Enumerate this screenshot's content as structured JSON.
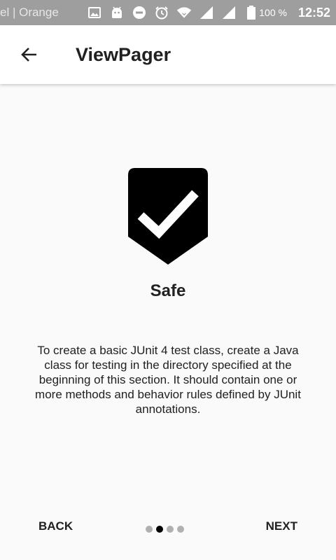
{
  "status_bar": {
    "carrier": "el | Orange",
    "battery": "100 %",
    "time": "12:52",
    "icons_left": [
      "image-icon",
      "android-icon",
      "do-not-disturb-icon",
      "alarm-icon",
      "wifi-icon",
      "signal-icon",
      "signal-icon-2",
      "battery-icon"
    ]
  },
  "app_bar": {
    "back_icon": "arrow-back-icon",
    "title": "ViewPager"
  },
  "page": {
    "icon": "shield-check-icon",
    "heading": "Safe",
    "body": "To create a basic JUnit 4 test class, create a Java class for testing in the directory specified at the beginning of this section. It should contain one or more methods and behavior rules defined by JUnit annotations."
  },
  "navigation": {
    "back_label": "BACK",
    "next_label": "NEXT",
    "page_count": 4,
    "current_page": 2
  },
  "colors": {
    "status_bar": "#9e9e9e",
    "background": "#fafafa",
    "text": "#212121",
    "dot_inactive": "#b0b0b0",
    "dot_active": "#000000"
  }
}
